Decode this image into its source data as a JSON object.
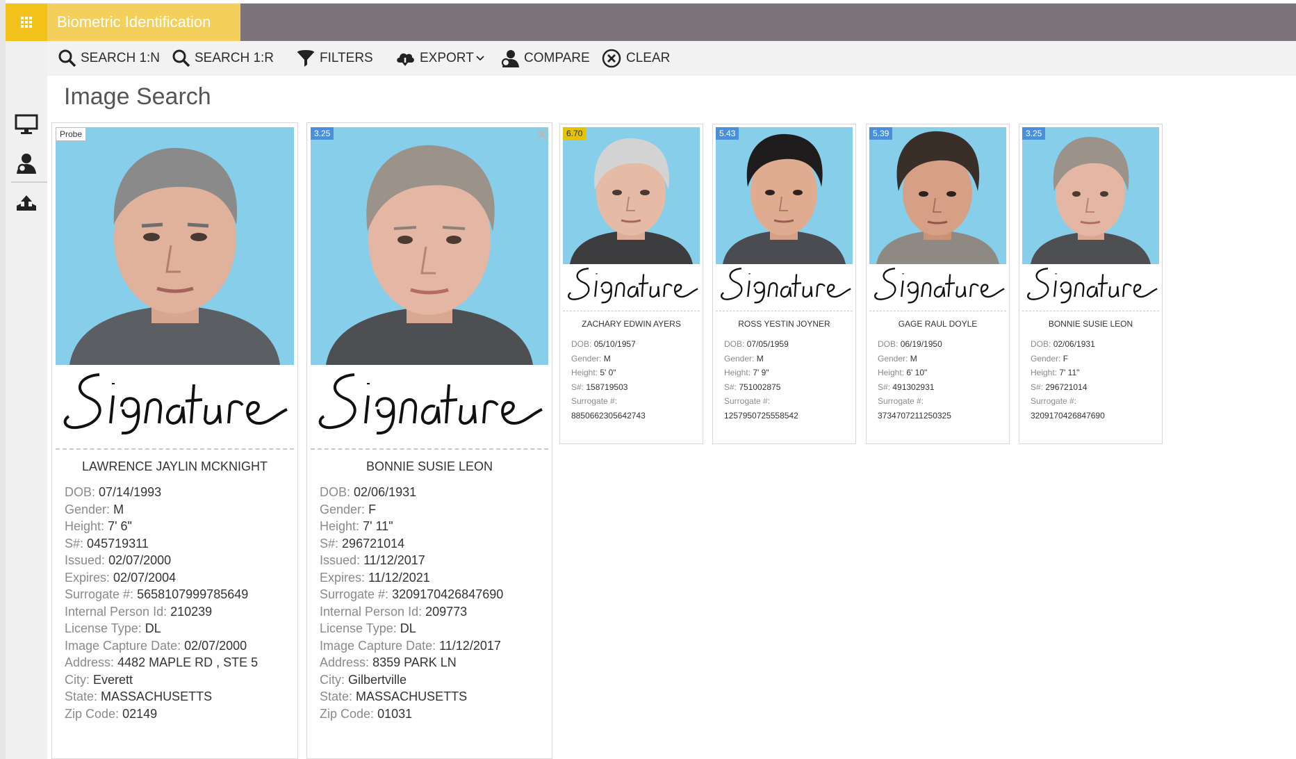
{
  "app": {
    "title": "Biometric Identification"
  },
  "toolbar": {
    "search_1n": "SEARCH 1:N",
    "search_1r": "SEARCH 1:R",
    "filters": "FILTERS",
    "export": "EXPORT",
    "compare": "COMPARE",
    "clear": "CLEAR"
  },
  "page": {
    "title": "Image Search"
  },
  "labels": {
    "dob": "DOB:",
    "gender": "Gender:",
    "height": "Height:",
    "s_num": "S#:",
    "issued": "Issued:",
    "expires": "Expires:",
    "surrogate": "Surrogate #:",
    "internal_id": "Internal Person Id:",
    "license_type": "License Type:",
    "capture_date": "Image Capture Date:",
    "address": "Address:",
    "city": "City:",
    "state": "State:",
    "zip": "Zip Code:"
  },
  "cards": [
    {
      "badge": "Probe",
      "signature": "Signature",
      "name": "LAWRENCE JAYLIN MCKNIGHT",
      "dob": "07/14/1993",
      "gender": "M",
      "height": "7' 6\"",
      "s_num": "045719311",
      "issued": "02/07/2000",
      "expires": "02/07/2004",
      "surrogate": "5658107999785649",
      "internal_id": "210239",
      "license_type": "DL",
      "capture_date": "02/07/2000",
      "address": "4482 MAPLE RD , STE 5",
      "city": "Everett",
      "state": "MASSACHUSETTS",
      "zip": "02149"
    },
    {
      "badge": "3.25",
      "signature": "Signature",
      "name": "BONNIE SUSIE LEON",
      "dob": "02/06/1931",
      "gender": "F",
      "height": "7' 11\"",
      "s_num": "296721014",
      "issued": "11/12/2017",
      "expires": "11/12/2021",
      "surrogate": "3209170426847690",
      "internal_id": "209773",
      "license_type": "DL",
      "capture_date": "11/12/2017",
      "address": "8359 PARK LN",
      "city": "Gilbertville",
      "state": "MASSACHUSETTS",
      "zip": "01031"
    },
    {
      "badge": "6.70",
      "signature": "Signature",
      "name": "ZACHARY EDWIN AYERS",
      "dob": "05/10/1957",
      "gender": "M",
      "height": "5' 0\"",
      "s_num": "158719503",
      "surrogate": "8850662305642743"
    },
    {
      "badge": "5.43",
      "signature": "Signature",
      "name": "ROSS YESTIN JOYNER",
      "dob": "07/05/1959",
      "gender": "M",
      "height": "7' 9\"",
      "s_num": "751002875",
      "surrogate": "1257950725558542"
    },
    {
      "badge": "5.39",
      "signature": "Signature",
      "name": "GAGE RAUL DOYLE",
      "dob": "06/19/1950",
      "gender": "M",
      "height": "6' 10\"",
      "s_num": "491302931",
      "surrogate": "3734707211250325"
    },
    {
      "badge": "3.25",
      "signature": "Signature",
      "name": "BONNIE SUSIE LEON",
      "dob": "02/06/1931",
      "gender": "F",
      "height": "7' 11\"",
      "s_num": "296721014",
      "surrogate": "3209170426847690"
    }
  ]
}
